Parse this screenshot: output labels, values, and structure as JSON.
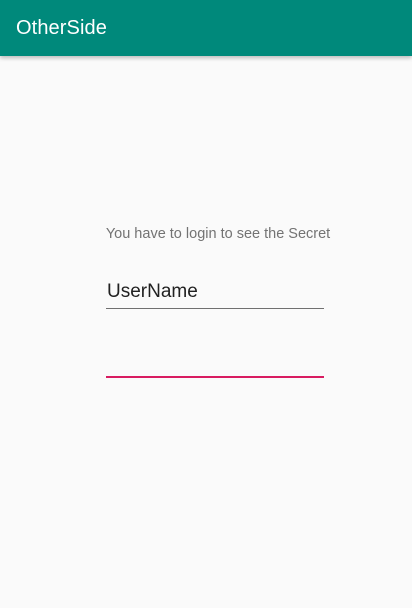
{
  "app": {
    "title": "OtherSide"
  },
  "login": {
    "message": "You have to login to see the Secret",
    "username_value": "UserName",
    "password_value": ""
  },
  "colors": {
    "app_bar": "#00897b",
    "accent": "#d81b60",
    "background": "#fafafa"
  }
}
